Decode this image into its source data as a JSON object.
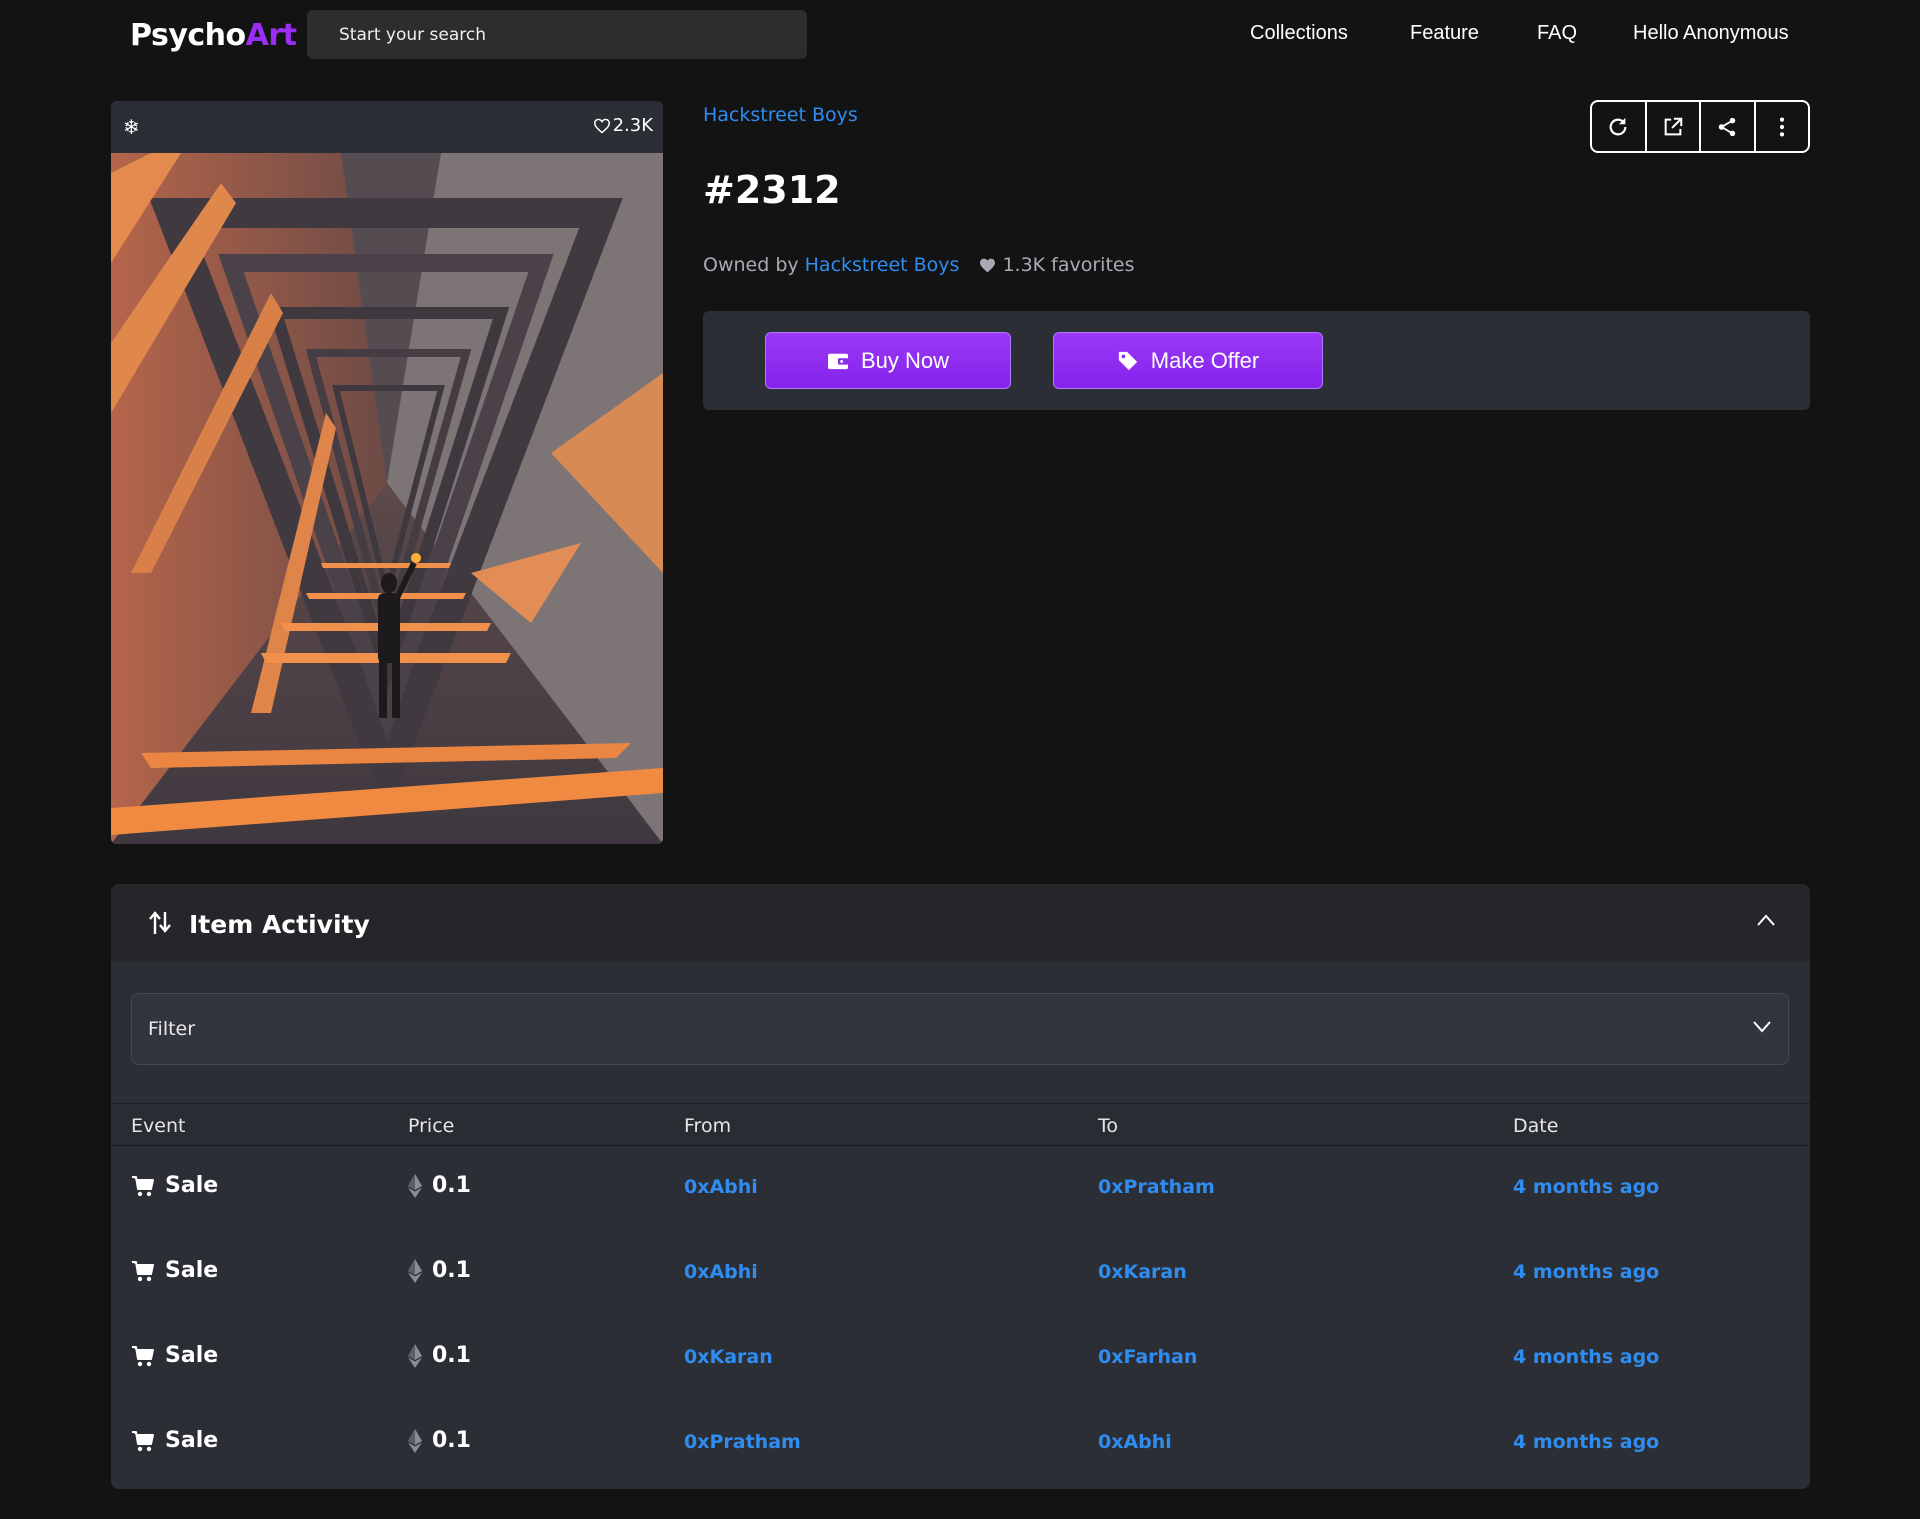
{
  "nav": {
    "logo_part1": "Psycho",
    "logo_part2": "Art",
    "search_placeholder": "Start your search",
    "links": [
      "Collections",
      "Feature",
      "FAQ",
      "Hello Anonymous"
    ]
  },
  "card": {
    "likes": "2.3K",
    "snow_icon": "snowflake-icon",
    "heart_icon": "heart-outline-icon"
  },
  "item": {
    "collection": "Hackstreet Boys",
    "title": "#2312",
    "owned_by_label": "Owned by",
    "owner": "Hackstreet Boys",
    "favorites": "1.3K favorites"
  },
  "tools": [
    "refresh-icon",
    "external-link-icon",
    "share-icon",
    "more-vertical-icon"
  ],
  "actions": {
    "buy_label": "Buy Now",
    "offer_label": "Make Offer"
  },
  "activity": {
    "title": "Item Activity",
    "filter_label": "Filter",
    "columns": [
      "Event",
      "Price",
      "From",
      "To",
      "Date"
    ],
    "rows": [
      {
        "event": "Sale",
        "price": "0.1",
        "from": "0xAbhi",
        "to": "0xPratham",
        "date": "4 months ago"
      },
      {
        "event": "Sale",
        "price": "0.1",
        "from": "0xAbhi",
        "to": "0xKaran",
        "date": "4 months ago"
      },
      {
        "event": "Sale",
        "price": "0.1",
        "from": "0xKaran",
        "to": "0xFarhan",
        "date": "4 months ago"
      },
      {
        "event": "Sale",
        "price": "0.1",
        "from": "0xPratham",
        "to": "0xAbhi",
        "date": "4 months ago"
      }
    ]
  },
  "colors": {
    "background": "#131314",
    "panel": "#2c2e35",
    "accent": "#9b2df5",
    "link": "#2f8cf0"
  }
}
